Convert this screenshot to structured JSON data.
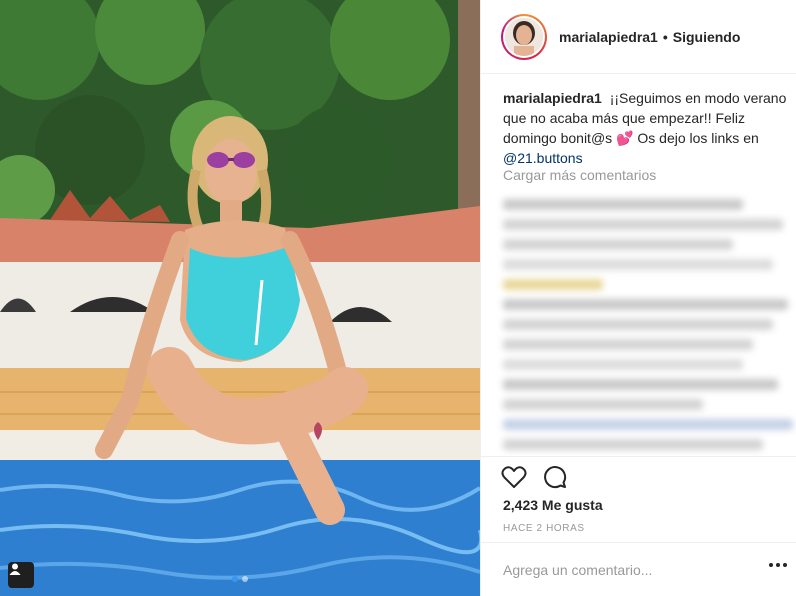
{
  "post": {
    "username": "marialapiedra1",
    "separator": "•",
    "follow_status": "Siguiendo",
    "caption_user": "marialapiedra1",
    "caption_text": " ¡¡Seguimos en modo verano que no acaba más que empezar!! Feliz domingo bonit@s 💕 Os dejo los links en ",
    "caption_mention": "@21.buttons",
    "load_more": "Cargar más comentarios",
    "likes": "2,423 Me gusta",
    "time_ago": "HACE 2 HORAS",
    "comment_placeholder": "Agrega un comentario...",
    "carousel": {
      "count": 2,
      "active": 1
    }
  },
  "icons": {
    "heart": "heart-icon",
    "comment": "comment-icon",
    "tagged": "tagged-user-icon",
    "more": "more-options-icon"
  },
  "colors": {
    "text": "#262626",
    "muted": "#999999",
    "mention": "#003569",
    "border": "#efefef",
    "active_dot": "#3897f0"
  }
}
